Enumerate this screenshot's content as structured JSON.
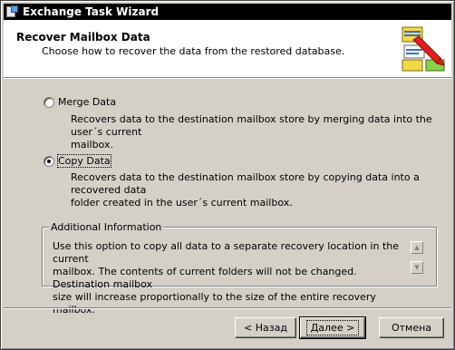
{
  "window": {
    "title": "Exchange Task Wizard"
  },
  "header": {
    "title": "Recover Mailbox Data",
    "subtitle": "Choose how to recover the data from the restored database."
  },
  "options": [
    {
      "label": "Merge Data",
      "checked": false,
      "description_lines": [
        "Recovers data to the destination mailbox store by merging data into the user´s current",
        "mailbox."
      ]
    },
    {
      "label": "Copy Data",
      "checked": true,
      "description_lines": [
        "Recovers data to the destination mailbox store by copying data into a recovered data",
        "folder created in the user´s current mailbox."
      ]
    }
  ],
  "additional_info": {
    "legend": "Additional Information",
    "lines": [
      "Use this option to copy all data to a separate recovery location in the current",
      "mailbox. The contents of current folders will not be changed. Destination mailbox",
      "size will increase proportionally to the size of the entire recovery mailbox."
    ]
  },
  "buttons": {
    "back": "< Назад",
    "next": "Далее >",
    "cancel": "Отмена"
  },
  "icons": {
    "app": "exchange-app-icon",
    "wizard": "wizard-document-icon",
    "scroll_up": "scroll-up-icon",
    "scroll_down": "scroll-down-icon"
  }
}
